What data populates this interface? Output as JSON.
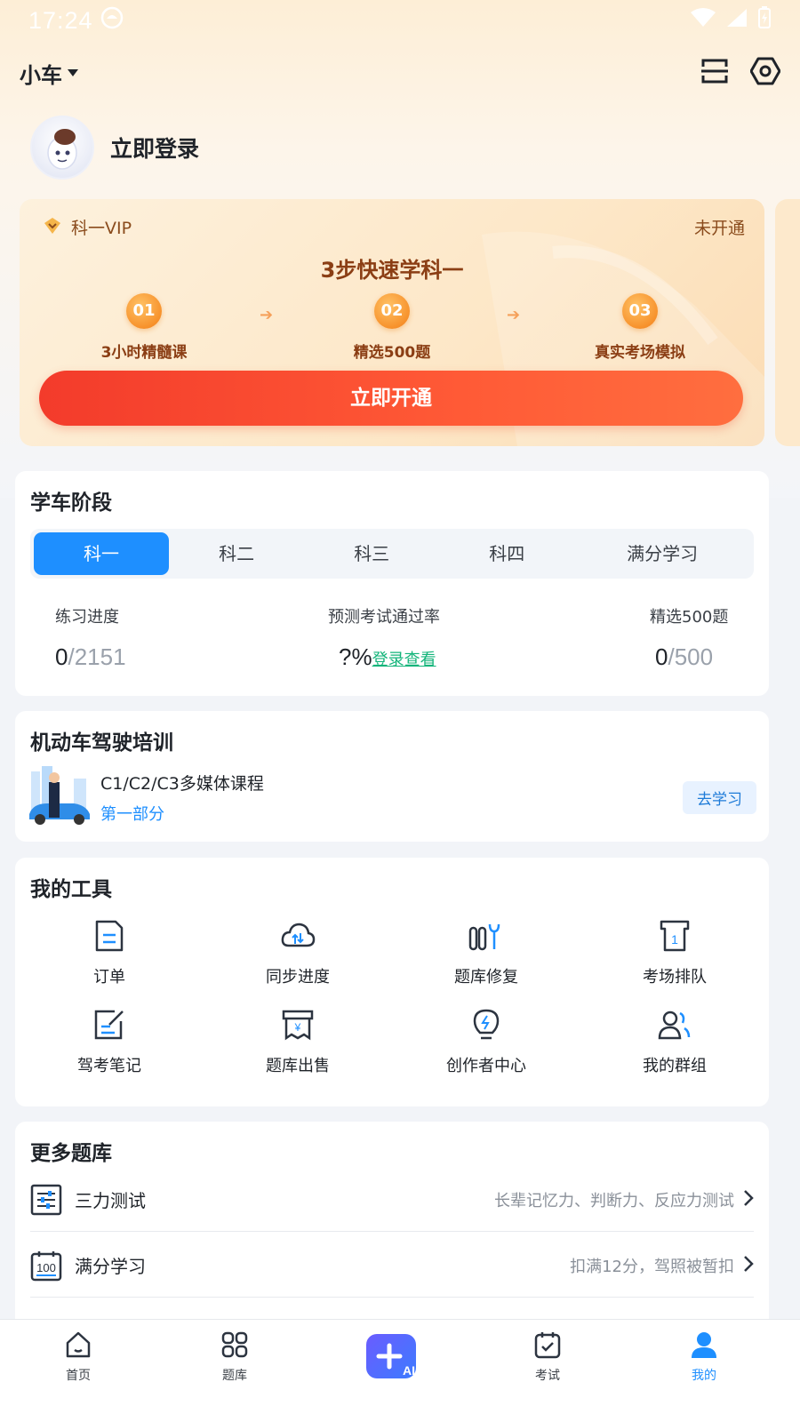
{
  "status_bar": {
    "time": "17:24"
  },
  "header": {
    "car_type": "小车"
  },
  "profile": {
    "login_text": "立即登录"
  },
  "vip": {
    "label": "科一VIP",
    "status": "未开通",
    "title": "3步快速学科一",
    "steps": [
      {
        "num": "01",
        "text": "3小时精髓课"
      },
      {
        "num": "02",
        "text": "精选500题"
      },
      {
        "num": "03",
        "text": "真实考场模拟"
      }
    ],
    "button": "立即开通",
    "colors": {
      "accent": "#f33b2b",
      "text": "#8b3e14"
    }
  },
  "stage": {
    "title": "学车阶段",
    "tabs": [
      "科一",
      "科二",
      "科三",
      "科四",
      "满分学习"
    ],
    "active_tab": "科一",
    "stats": [
      {
        "label": "练习进度",
        "value": "0",
        "total": "/2151"
      },
      {
        "label": "预测考试通过率",
        "value": "?%",
        "link": "登录查看"
      },
      {
        "label": "精选500题",
        "value": "0",
        "total": "/500"
      }
    ]
  },
  "training": {
    "title": "机动车驾驶培训",
    "course_name": "C1/C2/C3多媒体课程",
    "course_sub": "第一部分",
    "button": "去学习"
  },
  "tools": {
    "title": "我的工具",
    "items": [
      {
        "label": "订单",
        "icon": "order-icon"
      },
      {
        "label": "同步进度",
        "icon": "cloud-sync-icon"
      },
      {
        "label": "题库修复",
        "icon": "repair-icon"
      },
      {
        "label": "考场排队",
        "icon": "queue-icon"
      },
      {
        "label": "驾考笔记",
        "icon": "note-icon"
      },
      {
        "label": "题库出售",
        "icon": "sale-icon"
      },
      {
        "label": "创作者中心",
        "icon": "bulb-icon"
      },
      {
        "label": "我的群组",
        "icon": "group-icon"
      }
    ]
  },
  "more": {
    "title": "更多题库",
    "items": [
      {
        "label": "三力测试",
        "desc": "长辈记忆力、判断力、反应力测试",
        "icon": "sliders-icon"
      },
      {
        "label": "满分学习",
        "desc": "扣满12分，驾照被暂扣",
        "icon": "score-100-icon"
      }
    ]
  },
  "bottom_nav": {
    "items": [
      {
        "label": "首页",
        "icon": "home-icon"
      },
      {
        "label": "题库",
        "icon": "grid-icon"
      },
      {
        "label": "",
        "icon": "ai-plus-icon"
      },
      {
        "label": "考试",
        "icon": "exam-icon"
      },
      {
        "label": "我的",
        "icon": "user-icon"
      }
    ],
    "active": "我的",
    "accent": "#1e8fff"
  }
}
